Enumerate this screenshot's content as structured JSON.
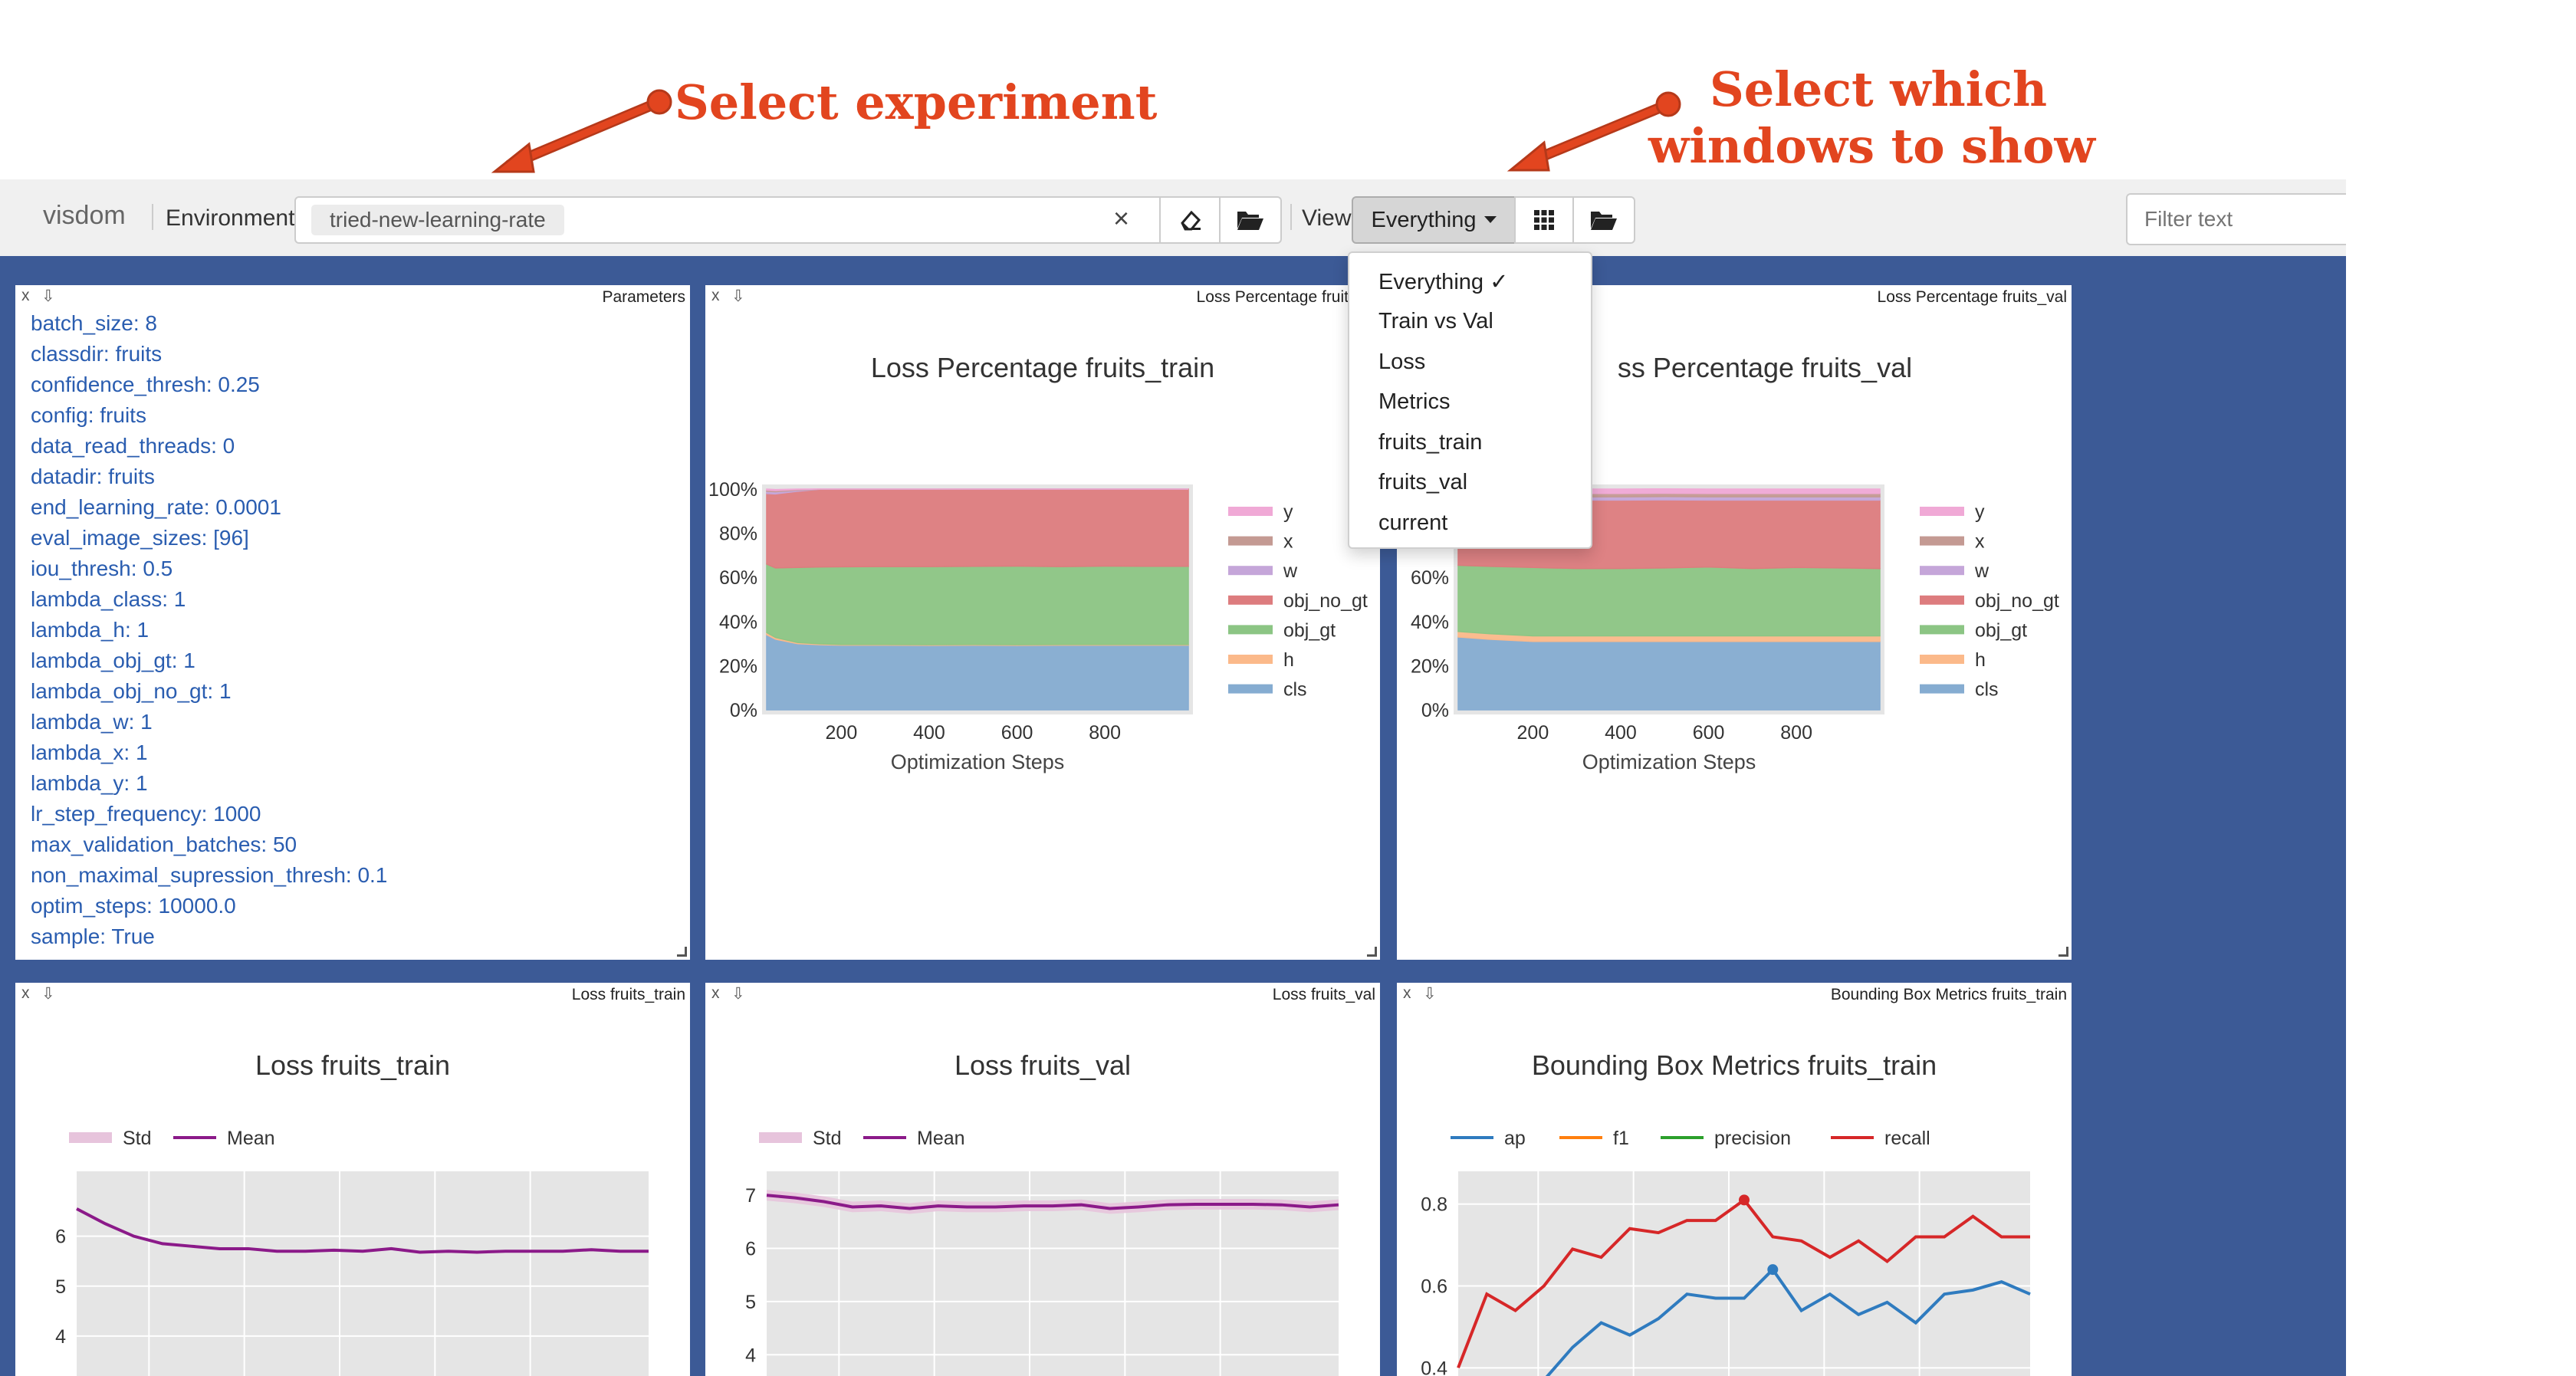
{
  "annotations": {
    "select_experiment": "Select experiment",
    "select_windows_line1": "Select which",
    "select_windows_line2": "windows to show"
  },
  "toolbar": {
    "app_name": "visdom",
    "environment_label": "Environment",
    "environment_value": "tried-new-learning-rate",
    "clear_symbol": "×",
    "view_label": "View",
    "view_selected": "Everything",
    "filter_placeholder": "Filter text"
  },
  "view_menu": {
    "items": [
      "Everything ✓",
      "Train vs Val",
      "Loss",
      "Metrics",
      "fruits_train",
      "fruits_val",
      "current"
    ]
  },
  "panes": {
    "parameters": {
      "title": "Parameters",
      "close": "x",
      "download": "⇩",
      "lines": [
        "batch_size: 8",
        "classdir: fruits",
        "confidence_thresh: 0.25",
        "config: fruits",
        "data_read_threads: 0",
        "datadir: fruits",
        "end_learning_rate: 0.0001",
        "eval_image_sizes: [96]",
        "iou_thresh: 0.5",
        "lambda_class: 1",
        "lambda_h: 1",
        "lambda_obj_gt: 1",
        "lambda_obj_no_gt: 1",
        "lambda_w: 1",
        "lambda_x: 1",
        "lambda_y: 1",
        "lr_step_frequency: 1000",
        "max_validation_batches: 50",
        "non_maximal_supression_thresh: 0.1",
        "optim_steps: 10000.0",
        "sample: True"
      ]
    },
    "loss_pct_train": {
      "header": "Loss Percentage fruits_tr",
      "title": "Loss Percentage fruits_train",
      "xlabel": "Optimization Steps"
    },
    "loss_pct_val": {
      "header": "Loss Percentage fruits_val",
      "title": "ss Percentage fruits_val",
      "xlabel": "Optimization Steps"
    },
    "loss_train": {
      "header": "Loss fruits_train",
      "title": "Loss fruits_train"
    },
    "loss_val": {
      "header": "Loss fruits_val",
      "title": "Loss fruits_val"
    },
    "bbox_train": {
      "header": "Bounding Box Metrics fruits_train",
      "title": "Bounding Box Metrics fruits_train"
    }
  },
  "colors": {
    "cls": "#85acd1",
    "h": "#fbb98a",
    "obj_gt": "#8cc584",
    "obj_no_gt": "#dd7c7e",
    "w": "#c5a6d9",
    "x": "#c49a93",
    "y": "#f0a9d6",
    "mean": "#8b1a89",
    "std": "#e7c4dc",
    "ap": "#2f7bbf",
    "f1": "#ff7f0e",
    "precision": "#2ca02c",
    "recall": "#d62728",
    "content_bg": "#3c5a96",
    "annotation": "#e2451f"
  },
  "chart_data": [
    {
      "type": "area",
      "title": "Loss Percentage fruits_train",
      "xlabel": "Optimization Steps",
      "ylabel": "",
      "x_ticks": [
        200,
        400,
        600,
        800
      ],
      "y_ticks": [
        "0%",
        "20%",
        "40%",
        "60%",
        "80%",
        "100%"
      ],
      "xlim": [
        30,
        990
      ],
      "ylim": [
        0,
        100
      ],
      "x": [
        30,
        50,
        100,
        150,
        200,
        300,
        400,
        500,
        600,
        700,
        800,
        900,
        990
      ],
      "stacked": true,
      "series": [
        {
          "name": "cls",
          "values": [
            34,
            32,
            30,
            29.5,
            29.3,
            29.3,
            29.2,
            29.3,
            29.2,
            29.3,
            29.3,
            29.3,
            29.3
          ]
        },
        {
          "name": "h",
          "values": [
            1,
            0.8,
            0.5,
            0.4,
            0.3,
            0.3,
            0.3,
            0.3,
            0.3,
            0.3,
            0.3,
            0.3,
            0.3
          ]
        },
        {
          "name": "obj_gt",
          "values": [
            31,
            31.5,
            34,
            34.8,
            35.2,
            35.3,
            35.4,
            35.4,
            35.6,
            35.3,
            35.5,
            35.4,
            35.4
          ]
        },
        {
          "name": "obj_no_gt",
          "values": [
            32,
            33.5,
            34.5,
            35.2,
            35.1,
            35.0,
            35.0,
            35.0,
            34.9,
            35.1,
            34.9,
            35.0,
            35.0
          ]
        },
        {
          "name": "w",
          "values": [
            1,
            1,
            0.5,
            0.05,
            0.05,
            0.05,
            0.05,
            0,
            0,
            0,
            0,
            0,
            0
          ]
        },
        {
          "name": "x",
          "values": [
            0.5,
            0.5,
            0.3,
            0.05,
            0.05,
            0.05,
            0.05,
            0,
            0,
            0,
            0,
            0,
            0
          ]
        },
        {
          "name": "y",
          "values": [
            0.5,
            0.5,
            0.2,
            0.05,
            0,
            0,
            0,
            0,
            0,
            0,
            0,
            0,
            0
          ]
        }
      ],
      "legend": [
        "y",
        "x",
        "w",
        "obj_no_gt",
        "obj_gt",
        "h",
        "cls"
      ]
    },
    {
      "type": "area",
      "title": "ss Percentage fruits_val",
      "xlabel": "Optimization Steps",
      "ylabel": "",
      "x_ticks": [
        200,
        400,
        600,
        800
      ],
      "y_ticks": [
        "0%",
        "20%",
        "40%",
        "60%",
        "80%"
      ],
      "xlim": [
        30,
        990
      ],
      "ylim": [
        0,
        100
      ],
      "x": [
        30,
        100,
        200,
        300,
        400,
        500,
        600,
        700,
        800,
        900,
        990
      ],
      "stacked": true,
      "series": [
        {
          "name": "cls",
          "values": [
            33,
            32,
            31,
            31,
            31,
            31,
            31,
            31,
            31,
            31,
            31
          ]
        },
        {
          "name": "h",
          "values": [
            2.5,
            2.5,
            2.5,
            2.5,
            2.5,
            2.5,
            2.5,
            2.5,
            2.5,
            2.5,
            2.5
          ]
        },
        {
          "name": "obj_gt",
          "values": [
            30,
            30.5,
            31,
            30.5,
            30.5,
            30.8,
            31.2,
            30.5,
            31,
            30.8,
            30.5
          ]
        },
        {
          "name": "obj_no_gt",
          "values": [
            29.5,
            30,
            30.5,
            31,
            31,
            30.8,
            30.3,
            31,
            30.5,
            30.7,
            31
          ]
        },
        {
          "name": "w",
          "values": [
            1.5,
            1.5,
            1.5,
            1.5,
            1.5,
            1.5,
            1.5,
            1.5,
            1.5,
            1.5,
            1.5
          ]
        },
        {
          "name": "x",
          "values": [
            1.5,
            1.5,
            1.5,
            1.5,
            1.5,
            1.5,
            1.5,
            1.5,
            1.5,
            1.5,
            1.5
          ]
        },
        {
          "name": "y",
          "values": [
            2,
            2,
            2,
            2,
            2,
            2,
            2,
            2,
            2,
            2,
            2
          ]
        }
      ],
      "legend": [
        "y",
        "x",
        "w",
        "obj_no_gt",
        "obj_gt",
        "h",
        "cls"
      ]
    },
    {
      "type": "line",
      "title": "Loss fruits_train",
      "y_ticks": [
        4,
        5,
        6
      ],
      "xlim": [
        0,
        20
      ],
      "ylim": [
        3.2,
        7.3
      ],
      "x": [
        0,
        1,
        2,
        3,
        4,
        5,
        6,
        7,
        8,
        9,
        10,
        11,
        12,
        13,
        14,
        15,
        16,
        17,
        18,
        19,
        20
      ],
      "series": [
        {
          "name": "Mean",
          "values": [
            6.55,
            6.25,
            6.0,
            5.85,
            5.8,
            5.75,
            5.75,
            5.7,
            5.7,
            5.72,
            5.7,
            5.75,
            5.68,
            5.7,
            5.68,
            5.7,
            5.7,
            5.7,
            5.73,
            5.7,
            5.7
          ]
        },
        {
          "name": "Std",
          "values": [
            0.02,
            0.02,
            0.02,
            0.02,
            0.02,
            0.02,
            0.02,
            0.02,
            0.02,
            0.02,
            0.02,
            0.02,
            0.02,
            0.02,
            0.02,
            0.02,
            0.02,
            0.02,
            0.02,
            0.02,
            0.02
          ]
        }
      ],
      "legend": [
        "Std",
        "Mean"
      ]
    },
    {
      "type": "line",
      "title": "Loss fruits_val",
      "y_ticks": [
        4,
        5,
        6,
        7
      ],
      "xlim": [
        0,
        20
      ],
      "ylim": [
        3.6,
        7.45
      ],
      "x": [
        0,
        1,
        2,
        3,
        4,
        5,
        6,
        7,
        8,
        9,
        10,
        11,
        12,
        13,
        14,
        15,
        16,
        17,
        18,
        19,
        20
      ],
      "series": [
        {
          "name": "Mean",
          "values": [
            7.0,
            6.95,
            6.88,
            6.78,
            6.8,
            6.75,
            6.8,
            6.78,
            6.78,
            6.8,
            6.8,
            6.82,
            6.75,
            6.78,
            6.82,
            6.83,
            6.83,
            6.83,
            6.82,
            6.78,
            6.82
          ]
        },
        {
          "name": "Std",
          "values": [
            0.1,
            0.1,
            0.1,
            0.1,
            0.1,
            0.1,
            0.1,
            0.1,
            0.1,
            0.1,
            0.1,
            0.1,
            0.1,
            0.1,
            0.1,
            0.1,
            0.1,
            0.1,
            0.1,
            0.1,
            0.1
          ]
        }
      ],
      "legend": [
        "Std",
        "Mean"
      ]
    },
    {
      "type": "line",
      "title": "Bounding Box Metrics fruits_train",
      "y_ticks": [
        0.4,
        0.6,
        0.8
      ],
      "xlim": [
        0,
        20
      ],
      "ylim": [
        0.38,
        0.88
      ],
      "x": [
        0,
        1,
        2,
        3,
        4,
        5,
        6,
        7,
        8,
        9,
        10,
        11,
        12,
        13,
        14,
        15,
        16,
        17,
        18,
        19,
        20
      ],
      "series": [
        {
          "name": "ap",
          "values": [
            0.3,
            0.32,
            0.35,
            0.37,
            0.45,
            0.51,
            0.48,
            0.52,
            0.58,
            0.57,
            0.57,
            0.64,
            0.54,
            0.58,
            0.53,
            0.56,
            0.51,
            0.58,
            0.59,
            0.61,
            0.58
          ]
        },
        {
          "name": "f1",
          "values": []
        },
        {
          "name": "precision",
          "values": []
        },
        {
          "name": "recall",
          "values": [
            0.4,
            0.58,
            0.54,
            0.6,
            0.69,
            0.67,
            0.74,
            0.73,
            0.76,
            0.76,
            0.81,
            0.72,
            0.71,
            0.67,
            0.71,
            0.66,
            0.72,
            0.72,
            0.77,
            0.72,
            0.72
          ]
        }
      ],
      "legend": [
        "ap",
        "f1",
        "precision",
        "recall"
      ]
    }
  ]
}
